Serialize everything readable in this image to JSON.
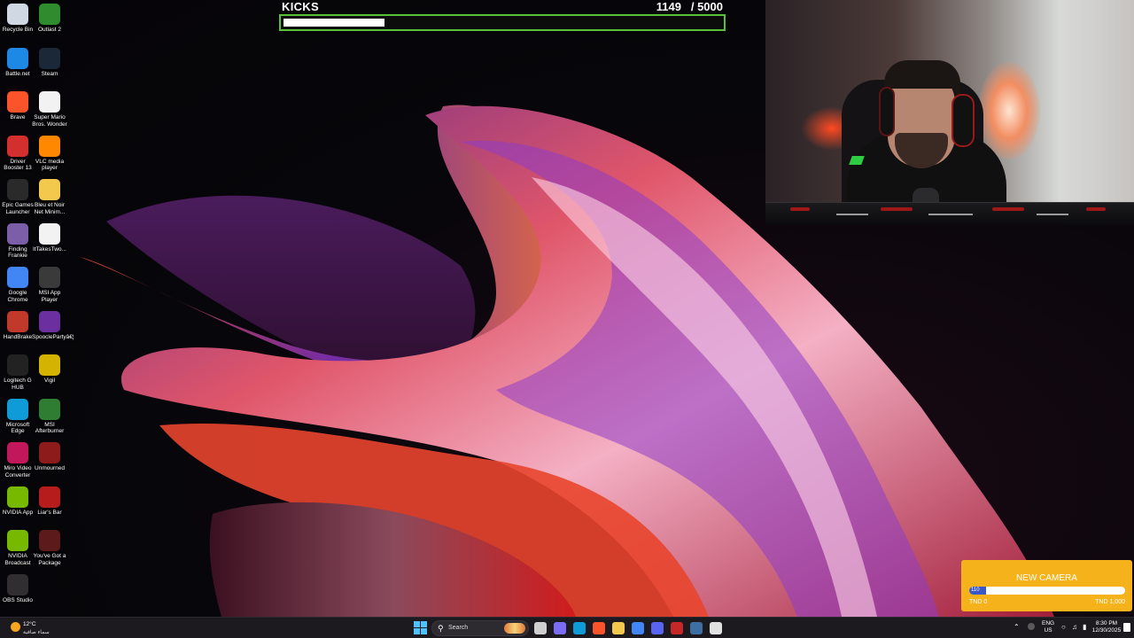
{
  "desktop_icons": [
    {
      "label": "Recycle Bin",
      "icon": "recycle-bin-icon",
      "color": "#cfd8e3"
    },
    {
      "label": "Outlast 2",
      "icon": "outlast-icon",
      "color": "#2e8b2e"
    },
    {
      "label": "Battle.net",
      "icon": "battlenet-icon",
      "color": "#1e88e5"
    },
    {
      "label": "Steam",
      "icon": "steam-icon",
      "color": "#1b2838"
    },
    {
      "label": "Brave",
      "icon": "brave-icon",
      "color": "#fb542b"
    },
    {
      "label": "Super Mario Bros. Wonder",
      "icon": "file-icon",
      "color": "#f2f2f2"
    },
    {
      "label": "Driver Booster 13",
      "icon": "driver-booster-icon",
      "color": "#d32f2f"
    },
    {
      "label": "VLC media player",
      "icon": "vlc-icon",
      "color": "#ff8800"
    },
    {
      "label": "Epic Games Launcher",
      "icon": "epic-games-icon",
      "color": "#2a2a2a"
    },
    {
      "label": "Bleu et Noir Net Minim...",
      "icon": "folder-icon",
      "color": "#f2c94c"
    },
    {
      "label": "Finding Frankie",
      "icon": "finding-frankie-icon",
      "color": "#7b5ea7"
    },
    {
      "label": "ItTakesTwo...",
      "icon": "file-icon",
      "color": "#f2f2f2"
    },
    {
      "label": "Google Chrome",
      "icon": "chrome-icon",
      "color": "#4285f4"
    },
    {
      "label": "MSI App Player",
      "icon": "msi-app-player-icon",
      "color": "#3a3a3a"
    },
    {
      "label": "HandBrake",
      "icon": "handbrake-icon",
      "color": "#c0392b"
    },
    {
      "label": "SpooclePartyâ€¦",
      "icon": "party-icon",
      "color": "#6b2fa0"
    },
    {
      "label": "Logitech G HUB",
      "icon": "logitech-icon",
      "color": "#222222"
    },
    {
      "label": "Vigil",
      "icon": "vigil-icon",
      "color": "#d4b400"
    },
    {
      "label": "Microsoft Edge",
      "icon": "edge-icon",
      "color": "#0f9bd7"
    },
    {
      "label": "MSI Afterburner",
      "icon": "msi-afterburner-icon",
      "color": "#2e7d32"
    },
    {
      "label": "Miro Video Converter",
      "icon": "miro-icon",
      "color": "#c2185b"
    },
    {
      "label": "Unmourned",
      "icon": "unmourned-icon",
      "color": "#8e1b1b"
    },
    {
      "label": "NVIDIA App",
      "icon": "nvidia-icon",
      "color": "#76b900"
    },
    {
      "label": "Liar's Bar",
      "icon": "liars-bar-icon",
      "color": "#b71c1c"
    },
    {
      "label": "NVIDIA Broadcast",
      "icon": "nvidia-broadcast-icon",
      "color": "#76b900"
    },
    {
      "label": "You've Got a Package",
      "icon": "package-icon",
      "color": "#5d1a1a"
    },
    {
      "label": "OBS Studio",
      "icon": "obs-icon",
      "color": "#302e31"
    }
  ],
  "kicks_goal": {
    "title": "KICKS",
    "current": "1149",
    "target": "/ 5000",
    "progress": 0.2298,
    "bar_color": "#58c13a"
  },
  "webcam": {
    "description_icon": "webcam-feed"
  },
  "camera_goal": {
    "title": "NEW CAMERA",
    "value": "110",
    "progress": 0.11,
    "min_label": "TND 0",
    "max_label": "TND 1,000",
    "bg_color": "#f6b21a",
    "fill_color": "#3a56c8"
  },
  "taskbar": {
    "weather_temp": "12°C",
    "weather_condition": "سماء صافية",
    "search_placeholder": "Search",
    "apps": [
      {
        "name": "task-view-icon",
        "color": "#cfcfcf"
      },
      {
        "name": "copilot-icon",
        "color": "#7b6cf6"
      },
      {
        "name": "edge-icon",
        "color": "#0f9bd7"
      },
      {
        "name": "brave-icon",
        "color": "#fb542b"
      },
      {
        "name": "file-explorer-icon",
        "color": "#f2c94c"
      },
      {
        "name": "chrome-icon",
        "color": "#4285f4"
      },
      {
        "name": "discord-icon",
        "color": "#5865f2"
      },
      {
        "name": "app-red-icon",
        "color": "#c62828"
      },
      {
        "name": "steam-icon",
        "color": "#3d6fa3"
      },
      {
        "name": "obs-icon",
        "color": "#e0e0e0"
      }
    ],
    "language": "ENG",
    "region": "US",
    "time": "8:30 PM",
    "date": "12/30/2025"
  }
}
